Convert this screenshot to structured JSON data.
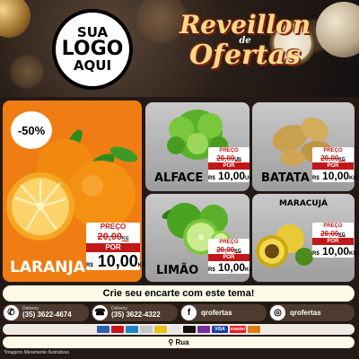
{
  "header": {
    "logo_lines": [
      "SUA",
      "LOGO",
      "AQUI"
    ],
    "title_line1": "Reveillon",
    "title_de": "de",
    "title_line2": "Ofertas"
  },
  "products": [
    {
      "id": "laranja",
      "name": "LARANJA",
      "discount": "-50%",
      "price_label": "PREÇO",
      "old_price": "20,00",
      "old_unit": "KG",
      "por": "POR",
      "currency": "R$",
      "new_price": "10,00",
      "unit": "KG"
    },
    {
      "id": "alface",
      "name": "ALFACE",
      "price_label": "PREÇO",
      "old_price": "20,00",
      "old_unit": "UN",
      "por": "POR",
      "currency": "R$",
      "new_price": "10,00",
      "unit": "UN"
    },
    {
      "id": "batata",
      "name": "BATATA",
      "price_label": "PREÇO",
      "old_price": "20,00",
      "old_unit": "KG",
      "por": "POR",
      "currency": "R$",
      "new_price": "10,00",
      "unit": "KG"
    },
    {
      "id": "limao",
      "name": "LIMÃO",
      "price_label": "PREÇO",
      "old_price": "20,00",
      "old_unit": "KG",
      "por": "POR",
      "currency": "R$",
      "new_price": "10,00",
      "unit": "KG"
    },
    {
      "id": "maracuja",
      "name": "MARACUJÁ",
      "price_label": "PREÇO",
      "old_price": "20,00",
      "old_unit": "KG",
      "por": "POR",
      "currency": "R$",
      "new_price": "10,00",
      "unit": "KG"
    }
  ],
  "cta": "Crie seu encarte com este tema!",
  "contacts": [
    {
      "label": "Delivery",
      "number": "(35) 3622-4674",
      "icon": "whatsapp-icon"
    },
    {
      "label": "Delivery",
      "number": "(35) 3622-4322",
      "icon": "phone-icon"
    },
    {
      "handle": "qrofertas",
      "icon": "facebook-icon"
    },
    {
      "handle": "qrofertas",
      "icon": "instagram-icon"
    }
  ],
  "payments": [
    "card",
    "card",
    "card",
    "card",
    "card",
    "card",
    "card",
    "card",
    "VISA",
    "master",
    "card"
  ],
  "address": "Rua",
  "footnote": "*Imagens Meramente Ilustrativas",
  "colors": {
    "accent": "#ef7d13",
    "price_red": "#c01818",
    "gold": "#f7d98a"
  }
}
